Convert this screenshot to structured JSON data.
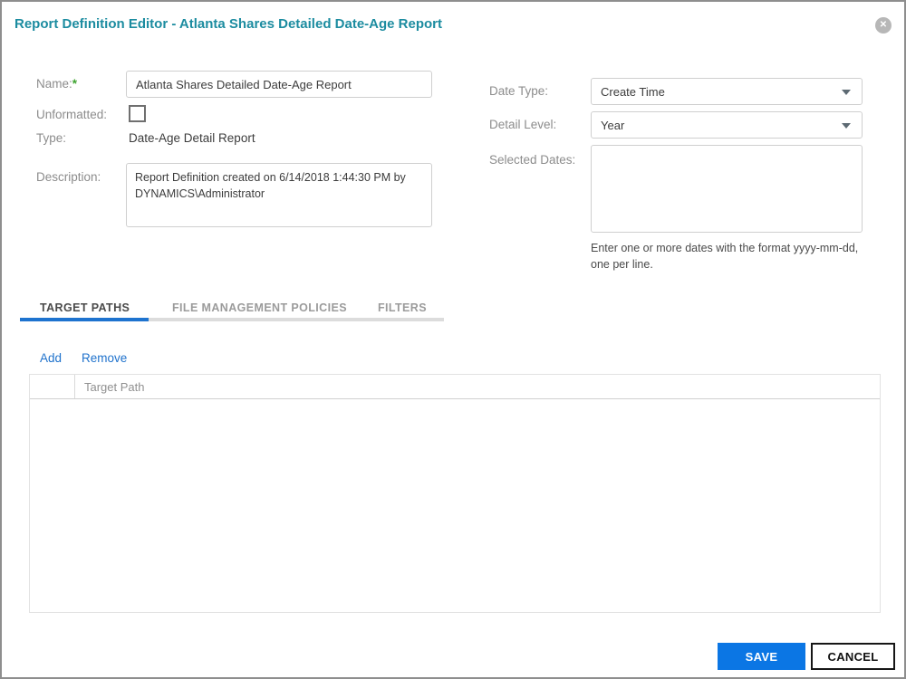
{
  "dialog": {
    "title": "Report Definition Editor - Atlanta Shares Detailed Date-Age Report",
    "close_glyph": "✕"
  },
  "form": {
    "name": {
      "label": "Name:",
      "required_mark": "*",
      "value": "Atlanta Shares Detailed Date-Age Report"
    },
    "unformatted": {
      "label": "Unformatted:",
      "checked": false
    },
    "type": {
      "label": "Type:",
      "value": "Date-Age Detail Report"
    },
    "description": {
      "label": "Description:",
      "value": "Report Definition created on 6/14/2018 1:44:30 PM by DYNAMICS\\Administrator"
    },
    "date_type": {
      "label": "Date Type:",
      "value": "Create Time"
    },
    "detail_level": {
      "label": "Detail Level:",
      "value": "Year"
    },
    "selected_dates": {
      "label": "Selected Dates:",
      "value": "",
      "hint": "Enter one or more dates with the format yyyy-mm-dd, one per line."
    }
  },
  "tabs": [
    {
      "label": "TARGET PATHS",
      "active": true
    },
    {
      "label": "FILE MANAGEMENT POLICIES",
      "active": false
    },
    {
      "label": "FILTERS",
      "active": false
    }
  ],
  "toolbar": {
    "add_label": "Add",
    "remove_label": "Remove"
  },
  "table": {
    "columns": [
      "",
      "Target Path"
    ],
    "rows": []
  },
  "footer": {
    "save_label": "SAVE",
    "cancel_label": "CANCEL"
  },
  "colors": {
    "title_teal": "#1c8ca0",
    "link_blue": "#1f72cc",
    "active_tab_underline": "#1e73cf",
    "save_button_blue": "#0b76e4",
    "required_green": "#3da32f",
    "label_gray": "#8c8c8c",
    "dialog_border_gray": "#8e8e8e"
  }
}
